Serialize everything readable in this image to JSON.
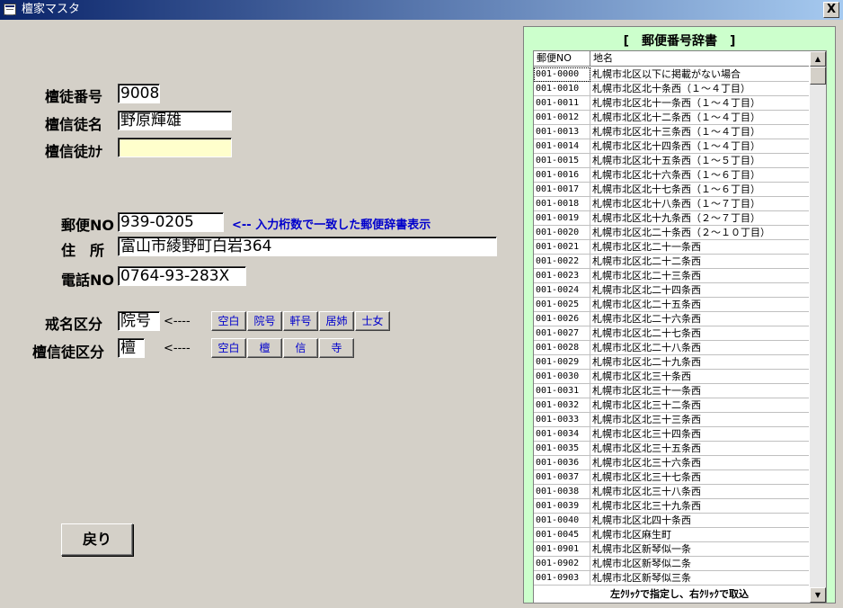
{
  "window": {
    "title": "檀家マスタ",
    "close": "X"
  },
  "form": {
    "dantoban_label": "檀徒番号",
    "dantoban_value": "9008",
    "name_label": "檀信徒名",
    "name_value": "野原輝雄",
    "kana_label": "檀信徒ｶﾅ",
    "kana_value": "",
    "postal_label": "郵便NO",
    "postal_value": "939-0205",
    "postal_hint": "<-- 入力桁数で一致した郵便辞書表示",
    "address_label": "住　所",
    "address_value": "富山市綾野町白岩364",
    "phone_label": "電話NO",
    "phone_value": "0764-93-283X",
    "kaimyo_label": "戒名区分",
    "kaimyo_value": "院号",
    "kaimyo_arrow": "<----",
    "kaimyo_buttons": [
      "空白",
      "院号",
      "軒号",
      "居姉",
      "士女"
    ],
    "danshinto_label": "檀信徒区分",
    "danshinto_value": "檀",
    "danshinto_arrow": "<----",
    "danshinto_buttons": [
      "空白",
      "檀",
      "信",
      "寺"
    ],
    "back_label": "戻り"
  },
  "dictionary": {
    "title": "[　郵便番号辞書　]",
    "col_code": "郵便NO",
    "col_name": "地名",
    "rows": [
      {
        "code": "001-0000",
        "name": "札幌市北区以下に掲載がない場合"
      },
      {
        "code": "001-0010",
        "name": "札幌市北区北十条西（１～４丁目）"
      },
      {
        "code": "001-0011",
        "name": "札幌市北区北十一条西（１～４丁目）"
      },
      {
        "code": "001-0012",
        "name": "札幌市北区北十二条西（１～４丁目）"
      },
      {
        "code": "001-0013",
        "name": "札幌市北区北十三条西（１～４丁目）"
      },
      {
        "code": "001-0014",
        "name": "札幌市北区北十四条西（１～４丁目）"
      },
      {
        "code": "001-0015",
        "name": "札幌市北区北十五条西（１～５丁目）"
      },
      {
        "code": "001-0016",
        "name": "札幌市北区北十六条西（１～６丁目）"
      },
      {
        "code": "001-0017",
        "name": "札幌市北区北十七条西（１～６丁目）"
      },
      {
        "code": "001-0018",
        "name": "札幌市北区北十八条西（１～７丁目）"
      },
      {
        "code": "001-0019",
        "name": "札幌市北区北十九条西（２～７丁目）"
      },
      {
        "code": "001-0020",
        "name": "札幌市北区北二十条西（２～１０丁目）"
      },
      {
        "code": "001-0021",
        "name": "札幌市北区北二十一条西"
      },
      {
        "code": "001-0022",
        "name": "札幌市北区北二十二条西"
      },
      {
        "code": "001-0023",
        "name": "札幌市北区北二十三条西"
      },
      {
        "code": "001-0024",
        "name": "札幌市北区北二十四条西"
      },
      {
        "code": "001-0025",
        "name": "札幌市北区北二十五条西"
      },
      {
        "code": "001-0026",
        "name": "札幌市北区北二十六条西"
      },
      {
        "code": "001-0027",
        "name": "札幌市北区北二十七条西"
      },
      {
        "code": "001-0028",
        "name": "札幌市北区北二十八条西"
      },
      {
        "code": "001-0029",
        "name": "札幌市北区北二十九条西"
      },
      {
        "code": "001-0030",
        "name": "札幌市北区北三十条西"
      },
      {
        "code": "001-0031",
        "name": "札幌市北区北三十一条西"
      },
      {
        "code": "001-0032",
        "name": "札幌市北区北三十二条西"
      },
      {
        "code": "001-0033",
        "name": "札幌市北区北三十三条西"
      },
      {
        "code": "001-0034",
        "name": "札幌市北区北三十四条西"
      },
      {
        "code": "001-0035",
        "name": "札幌市北区北三十五条西"
      },
      {
        "code": "001-0036",
        "name": "札幌市北区北三十六条西"
      },
      {
        "code": "001-0037",
        "name": "札幌市北区北三十七条西"
      },
      {
        "code": "001-0038",
        "name": "札幌市北区北三十八条西"
      },
      {
        "code": "001-0039",
        "name": "札幌市北区北三十九条西"
      },
      {
        "code": "001-0040",
        "name": "札幌市北区北四十条西"
      },
      {
        "code": "001-0045",
        "name": "札幌市北区麻生町"
      },
      {
        "code": "001-0901",
        "name": "札幌市北区新琴似一条"
      },
      {
        "code": "001-0902",
        "name": "札幌市北区新琴似二条"
      },
      {
        "code": "001-0903",
        "name": "札幌市北区新琴似三条"
      }
    ],
    "footer": "左ｸﾘｯｸで指定し、右ｸﾘｯｸで取込"
  }
}
